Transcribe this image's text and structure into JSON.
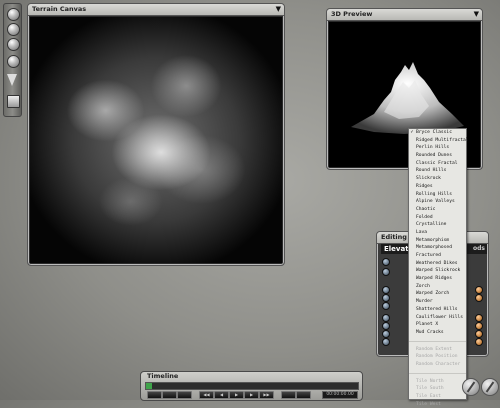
{
  "windows": {
    "terrain_canvas": {
      "title": "Terrain Canvas"
    },
    "preview": {
      "title": "3D Preview"
    },
    "editing": {
      "title": "Editing To",
      "header": "Elevatio",
      "right_label": "ods"
    }
  },
  "menu": {
    "items": [
      {
        "label": "Bryce Classic",
        "checked": true,
        "enabled": true
      },
      {
        "label": "Ridged Multifractal",
        "enabled": true
      },
      {
        "label": "Perlin Hills",
        "enabled": true
      },
      {
        "label": "Rounded Dunes",
        "enabled": true
      },
      {
        "label": "Classic Fractal",
        "enabled": true
      },
      {
        "label": "Round Hills",
        "enabled": true
      },
      {
        "label": "Slickrock",
        "enabled": true
      },
      {
        "label": "Ridges",
        "enabled": true
      },
      {
        "label": "Rolling Hills",
        "enabled": true
      },
      {
        "label": "Alpine Valleys",
        "enabled": true
      },
      {
        "label": "Chaotic",
        "enabled": true
      },
      {
        "label": "Folded",
        "enabled": true
      },
      {
        "label": "Crystalline",
        "enabled": true
      },
      {
        "label": "Lava",
        "enabled": true
      },
      {
        "label": "Metamorphism",
        "enabled": true
      },
      {
        "label": "Metamorphosed",
        "enabled": true
      },
      {
        "label": "Fractured",
        "enabled": true
      },
      {
        "label": "Weathered Dikes",
        "enabled": true
      },
      {
        "label": "Warped Slickrock",
        "enabled": true
      },
      {
        "label": "Warped Ridges",
        "enabled": true
      },
      {
        "label": "Zorch",
        "enabled": true
      },
      {
        "label": "Warped Zorch",
        "enabled": true
      },
      {
        "label": "Murder",
        "enabled": true
      },
      {
        "label": "Shattered Hills",
        "enabled": true
      },
      {
        "label": "Cauliflower Hills",
        "enabled": true
      },
      {
        "label": "Planet X",
        "enabled": true
      },
      {
        "label": "Mud Cracks",
        "enabled": true
      }
    ],
    "random_items": [
      {
        "label": "Random Extent",
        "enabled": false
      },
      {
        "label": "Random Position",
        "enabled": false
      },
      {
        "label": "Random Character",
        "enabled": false
      }
    ],
    "tile_items": [
      {
        "label": "Tile North",
        "enabled": false
      },
      {
        "label": "Tile South",
        "enabled": false
      },
      {
        "label": "Tile East",
        "enabled": false
      },
      {
        "label": "Tile West",
        "enabled": false
      }
    ]
  },
  "timeline": {
    "title": "Timeline",
    "time_display": "00:00:00.00",
    "progress": 0.03,
    "colors": {
      "progress": "#3fa34a"
    }
  },
  "toolstrip": {
    "icons": [
      "sphere-tool-icon",
      "sphere-tool-icon",
      "sphere-tool-icon",
      "sphere-tool-icon",
      "cone-tool-icon",
      "square-tool-icon"
    ]
  }
}
